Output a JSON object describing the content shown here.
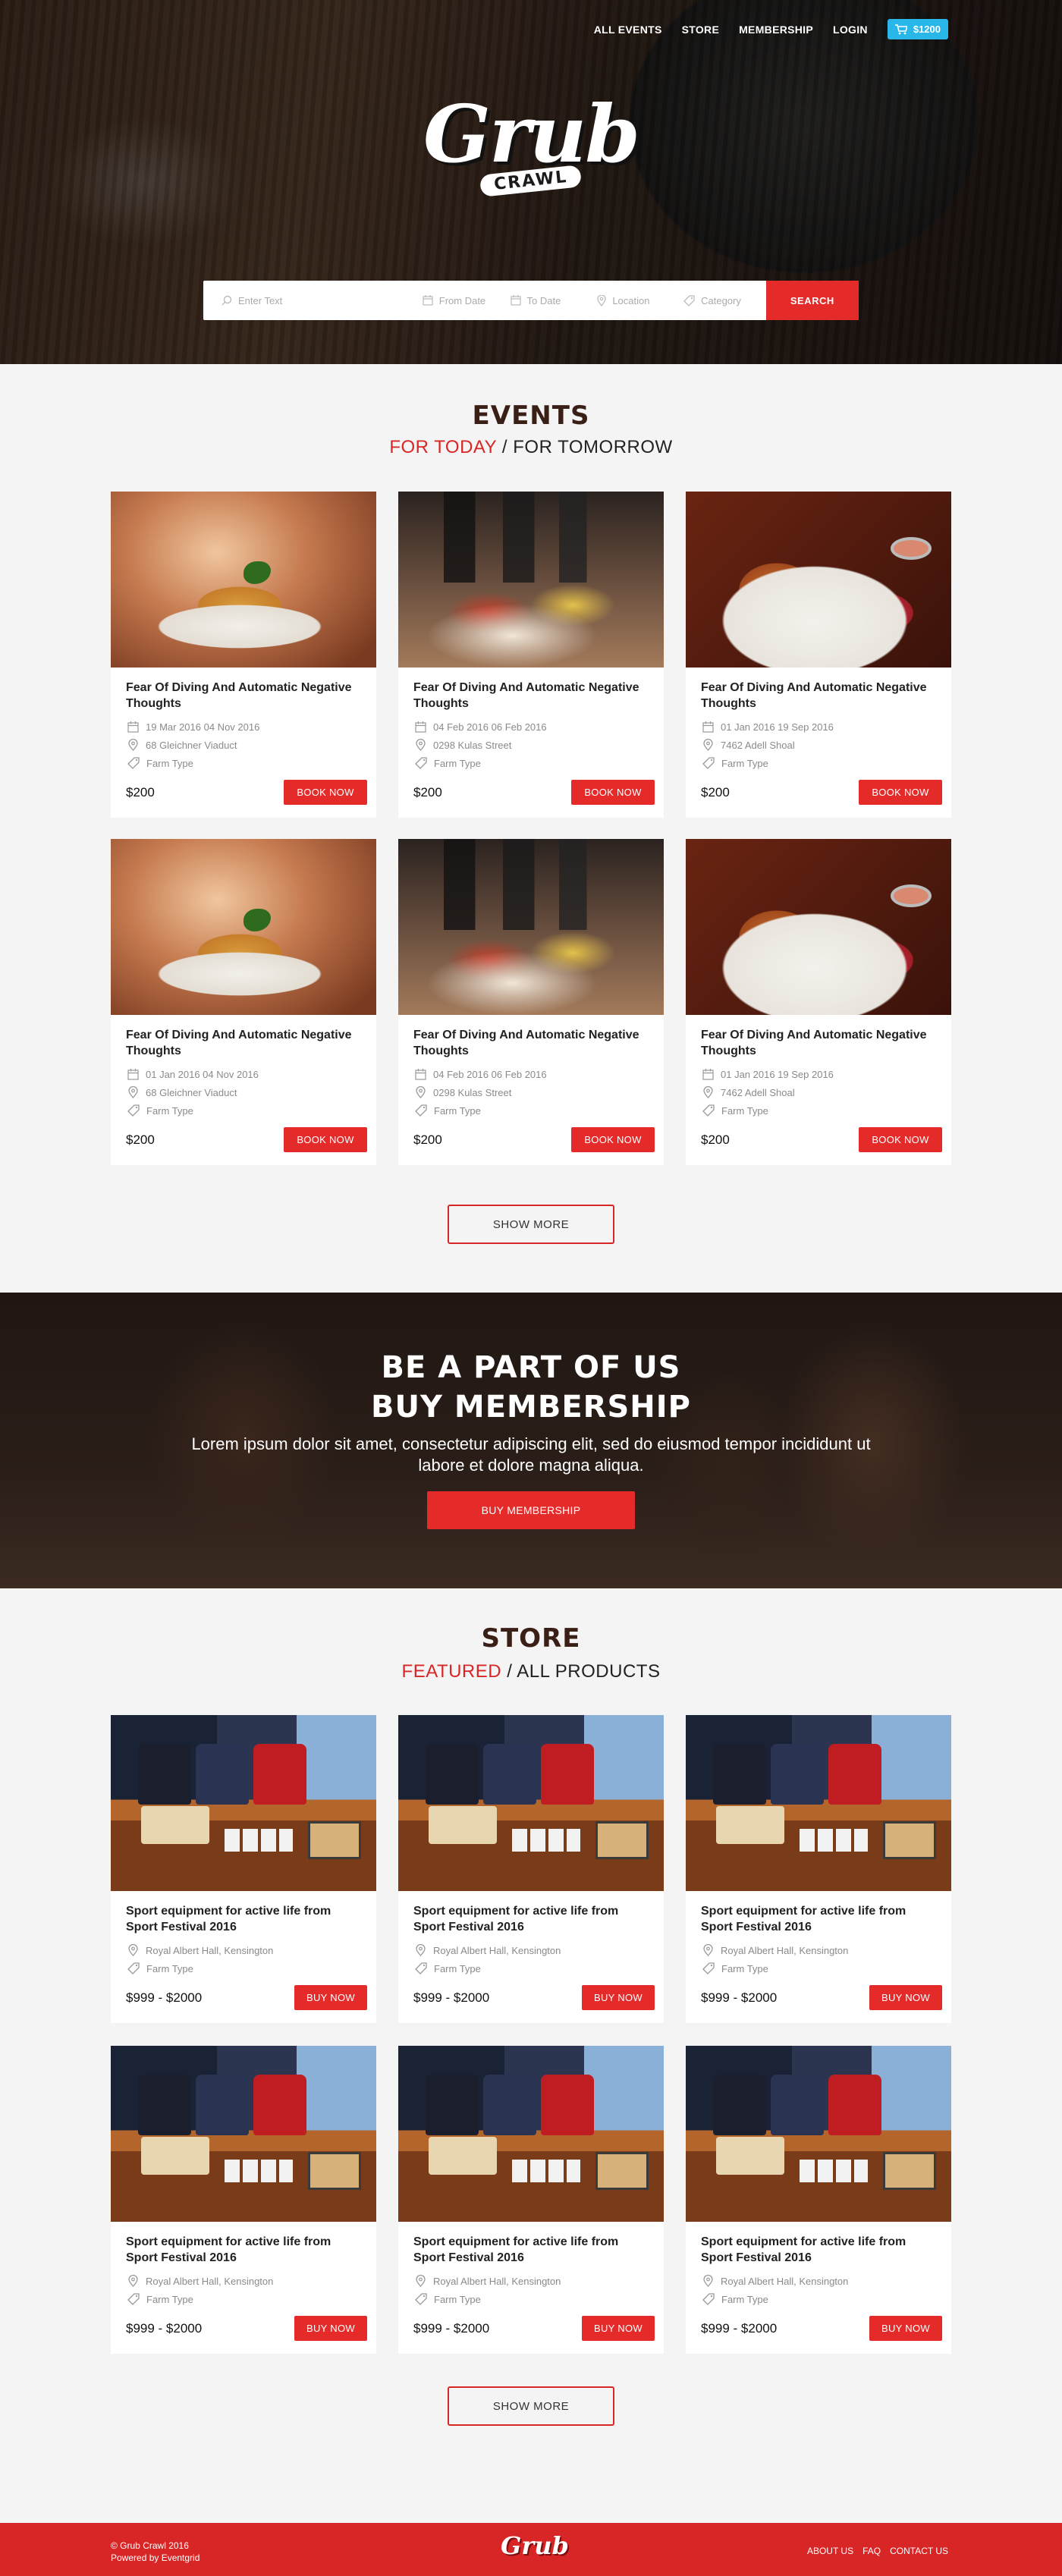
{
  "nav": {
    "items": [
      "ALL EVENTS",
      "STORE",
      "MEMBERSHIP",
      "LOGIN"
    ],
    "cart_total": "$1200",
    "icons": {
      "cart": "shopping-cart-icon"
    }
  },
  "logo": {
    "main": "Grub",
    "sub": "CRAWL"
  },
  "search": {
    "text_placeholder": "Enter Text",
    "from_placeholder": "From Date",
    "to_placeholder": "To Date",
    "location_placeholder": "Location",
    "category_placeholder": "Category",
    "button": "SEARCH"
  },
  "events": {
    "title": "EVENTS",
    "tab_active": "FOR TODAY",
    "separator": " / ",
    "tab_other": "FOR TOMORROW",
    "cards": [
      {
        "title": "Fear Of Diving And Automatic Negative Thoughts",
        "dates": "19 Mar 2016 04 Nov 2016",
        "address": "68 Gleichner Viaduct",
        "type": "Farm Type",
        "price": "$200",
        "button": "BOOK NOW",
        "image": "pasta-dish"
      },
      {
        "title": "Fear Of Diving And Automatic Negative Thoughts",
        "dates": "04 Feb 2016 06 Feb 2016",
        "address": "0298 Kulas Street",
        "type": "Farm Type",
        "price": "$200",
        "button": "BOOK NOW",
        "image": "buffet-line"
      },
      {
        "title": "Fear Of Diving And Automatic Negative Thoughts",
        "dates": "01 Jan 2016 19 Sep 2016",
        "address": "7462 Adell Shoal",
        "type": "Farm Type",
        "price": "$200",
        "button": "BOOK NOW",
        "image": "onion-rings-plate"
      },
      {
        "title": "Fear Of Diving And Automatic Negative Thoughts",
        "dates": "01 Jan 2016 04 Nov 2016",
        "address": "68 Gleichner Viaduct",
        "type": "Farm Type",
        "price": "$200",
        "button": "BOOK NOW",
        "image": "pasta-dish"
      },
      {
        "title": "Fear Of Diving And Automatic Negative Thoughts",
        "dates": "04 Feb 2016 06 Feb 2016",
        "address": "0298 Kulas Street",
        "type": "Farm Type",
        "price": "$200",
        "button": "BOOK NOW",
        "image": "buffet-line"
      },
      {
        "title": "Fear Of Diving And Automatic Negative Thoughts",
        "dates": "01 Jan 2016 19 Sep 2016",
        "address": "7462 Adell Shoal",
        "type": "Farm Type",
        "price": "$200",
        "button": "BOOK NOW",
        "image": "onion-rings-plate"
      }
    ],
    "show_more": "SHOW MORE"
  },
  "membership": {
    "line1": "BE A PART OF US",
    "line2": "BUY MEMBERSHIP",
    "text": "Lorem ipsum dolor sit amet, consectetur adipiscing elit, sed do eiusmod tempor incididunt ut labore et dolore magna aliqua.",
    "button": "BUY MEMBERSHIP"
  },
  "store": {
    "title": "STORE",
    "tab_active": "FEATURED",
    "separator": " / ",
    "tab_other": "ALL PRODUCTS",
    "cards": [
      {
        "title": "Sport equipment for active life from Sport Festival 2016",
        "address": "Royal Albert Hall, Kensington",
        "type": "Farm Type",
        "price": "$999 - $2000",
        "button": "BUY NOW"
      },
      {
        "title": "Sport equipment for active life from Sport Festival 2016",
        "address": "Royal Albert Hall, Kensington",
        "type": "Farm Type",
        "price": "$999 - $2000",
        "button": "BUY NOW"
      },
      {
        "title": "Sport equipment for active life from Sport Festival 2016",
        "address": "Royal Albert Hall, Kensington",
        "type": "Farm Type",
        "price": "$999 - $2000",
        "button": "BUY NOW"
      },
      {
        "title": "Sport equipment for active life from Sport Festival 2016",
        "address": "Royal Albert Hall, Kensington",
        "type": "Farm Type",
        "price": "$999 - $2000",
        "button": "BUY NOW"
      },
      {
        "title": "Sport equipment for active life from Sport Festival 2016",
        "address": "Royal Albert Hall, Kensington",
        "type": "Farm Type",
        "price": "$999 - $2000",
        "button": "BUY NOW"
      },
      {
        "title": "Sport equipment for active life from Sport Festival 2016",
        "address": "Royal Albert Hall, Kensington",
        "type": "Farm Type",
        "price": "$999 - $2000",
        "button": "BUY NOW"
      }
    ],
    "show_more": "SHOW MORE"
  },
  "footer": {
    "copyright": "© Grub Crawl 2016",
    "powered": "Powered by Eventgrid",
    "logo": "Grub",
    "links": [
      "ABOUT US",
      "FAQ",
      "CONTACT US"
    ]
  },
  "colors": {
    "accent": "#e52a2a",
    "cart": "#29b6e8",
    "heading": "#3a1f16",
    "background": "#f5f4f4"
  }
}
